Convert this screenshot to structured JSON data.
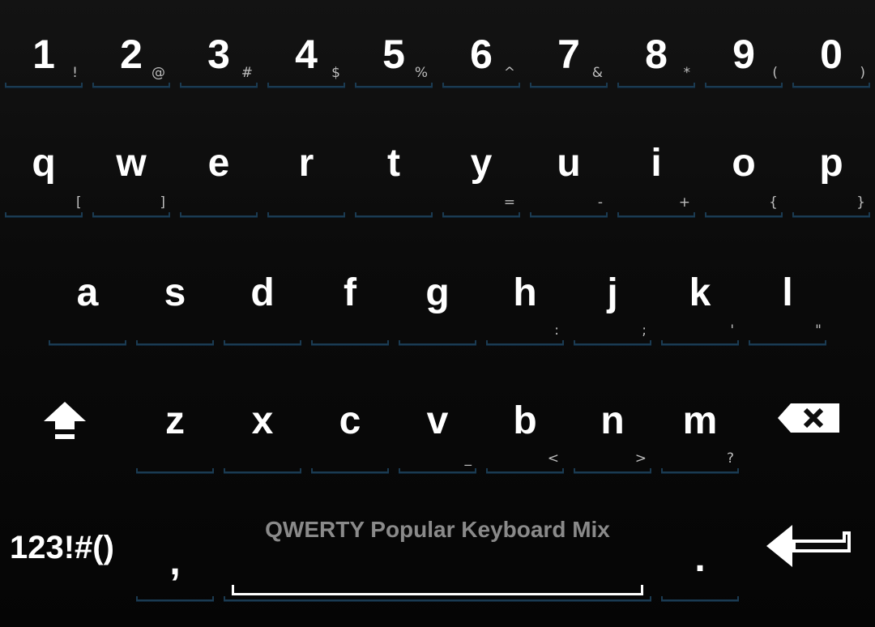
{
  "keyboard": {
    "row1": [
      {
        "main": "1",
        "alt": "!"
      },
      {
        "main": "2",
        "alt": "@"
      },
      {
        "main": "3",
        "alt": "#"
      },
      {
        "main": "4",
        "alt": "$"
      },
      {
        "main": "5",
        "alt": "%"
      },
      {
        "main": "6",
        "alt": "^"
      },
      {
        "main": "7",
        "alt": "&"
      },
      {
        "main": "8",
        "alt": "*"
      },
      {
        "main": "9",
        "alt": "("
      },
      {
        "main": "0",
        "alt": ")"
      }
    ],
    "row2": [
      {
        "main": "q",
        "alt": "["
      },
      {
        "main": "w",
        "alt": "]"
      },
      {
        "main": "e",
        "alt": ""
      },
      {
        "main": "r",
        "alt": ""
      },
      {
        "main": "t",
        "alt": ""
      },
      {
        "main": "y",
        "alt": "="
      },
      {
        "main": "u",
        "alt": "-"
      },
      {
        "main": "i",
        "alt": "+"
      },
      {
        "main": "o",
        "alt": "{"
      },
      {
        "main": "p",
        "alt": "}"
      }
    ],
    "row3": [
      {
        "main": "a",
        "alt": ""
      },
      {
        "main": "s",
        "alt": ""
      },
      {
        "main": "d",
        "alt": ""
      },
      {
        "main": "f",
        "alt": ""
      },
      {
        "main": "g",
        "alt": ""
      },
      {
        "main": "h",
        "alt": ":"
      },
      {
        "main": "j",
        "alt": ";"
      },
      {
        "main": "k",
        "alt": "'"
      },
      {
        "main": "l",
        "alt": "\""
      }
    ],
    "row4": [
      {
        "main": "z",
        "alt": ""
      },
      {
        "main": "x",
        "alt": ""
      },
      {
        "main": "c",
        "alt": ""
      },
      {
        "main": "v",
        "alt": "_"
      },
      {
        "main": "b",
        "alt": "<"
      },
      {
        "main": "n",
        "alt": ">"
      },
      {
        "main": "m",
        "alt": "?"
      }
    ],
    "symbols_label": "123!#()",
    "comma": ",",
    "period": ".",
    "space_label": "QWERTY Popular Keyboard Mix",
    "icons": {
      "shift": "shift-icon",
      "backspace": "backspace-icon",
      "enter": "enter-icon"
    },
    "colors": {
      "key_text": "#ffffff",
      "alt_text": "#bdbdbd",
      "underline": "#1b3b52",
      "space_label": "#8a8a8a"
    }
  }
}
